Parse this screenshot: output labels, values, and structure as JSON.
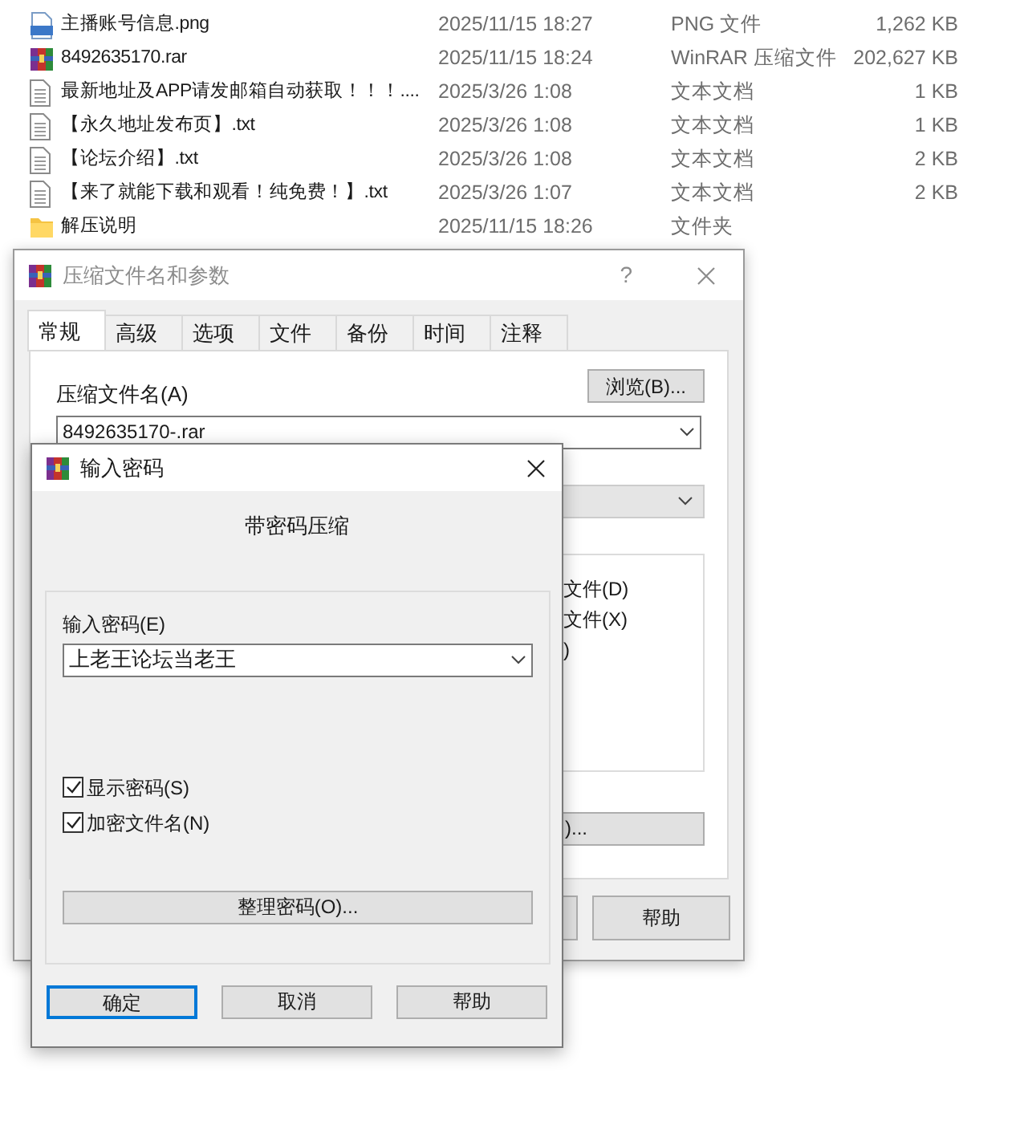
{
  "files": [
    {
      "kind": "png",
      "name": "主播账号信息.png",
      "date": "2025/11/15 18:27",
      "type": "PNG 文件",
      "size": "1,262 KB"
    },
    {
      "kind": "rar",
      "name": "8492635170.rar",
      "date": "2025/11/15 18:24",
      "type": "WinRAR 压缩文件",
      "size": "202,627 KB"
    },
    {
      "kind": "txt",
      "name": "最新地址及APP请发邮箱自动获取！！！....",
      "date": "2025/3/26 1:08",
      "type": "文本文档",
      "size": "1 KB"
    },
    {
      "kind": "txt",
      "name": "【永久地址发布页】.txt",
      "date": "2025/3/26 1:08",
      "type": "文本文档",
      "size": "1 KB"
    },
    {
      "kind": "txt",
      "name": "【论坛介绍】.txt",
      "date": "2025/3/26 1:08",
      "type": "文本文档",
      "size": "2 KB"
    },
    {
      "kind": "txt",
      "name": "【来了就能下载和观看！纯免费！】.txt",
      "date": "2025/3/26 1:07",
      "type": "文本文档",
      "size": "2 KB"
    },
    {
      "kind": "folder",
      "name": "解压说明",
      "date": "2025/11/15 18:26",
      "type": "文件夹"
    }
  ],
  "archive_dialog": {
    "title": "压缩文件名和参数",
    "help_glyph": "?",
    "tabs": [
      {
        "label": "常规",
        "selected": true
      },
      {
        "label": "高级",
        "selected": false
      },
      {
        "label": "选项",
        "selected": false
      },
      {
        "label": "文件",
        "selected": false
      },
      {
        "label": "备份",
        "selected": false
      },
      {
        "label": "时间",
        "selected": false
      },
      {
        "label": "注释",
        "selected": false
      }
    ],
    "archive_name_label": "压缩文件名(A)",
    "browse_button": "浏览(B)...",
    "archive_name_value": "8492635170-.rar",
    "option_fragments": [
      "文件(D)",
      "文件(X)",
      ")"
    ],
    "partial_button": ")...",
    "help_button": "帮助"
  },
  "password_dialog": {
    "title": "输入密码",
    "heading": "带密码压缩",
    "password_label": "输入密码(E)",
    "password_value": "上老王论坛当老王",
    "checkboxes": [
      {
        "label": "显示密码(S)",
        "checked": true
      },
      {
        "label": "加密文件名(N)",
        "checked": true
      }
    ],
    "organize_button": "整理密码(O)...",
    "buttons": [
      {
        "label": "确定",
        "default": true
      },
      {
        "label": "取消",
        "default": false
      },
      {
        "label": "帮助",
        "default": false
      }
    ]
  }
}
